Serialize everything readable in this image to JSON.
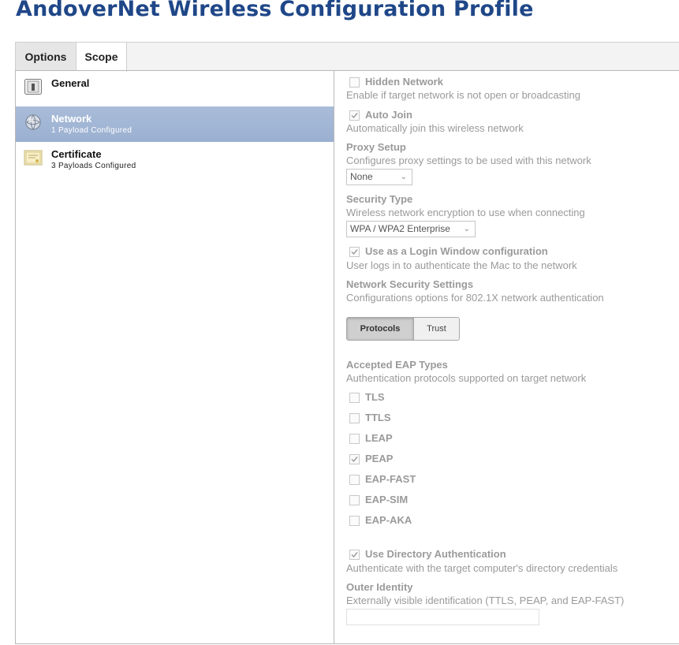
{
  "page_title": "AndoverNet Wireless Configuration Profile",
  "tabs": [
    {
      "label": "Options"
    },
    {
      "label": "Scope"
    }
  ],
  "sidebar": {
    "items": [
      {
        "title": "General",
        "subtitle": ""
      },
      {
        "title": "Network",
        "subtitle": "1 Payload Configured"
      },
      {
        "title": "Certificate",
        "subtitle": "3 Payloads Configured"
      }
    ]
  },
  "network": {
    "hidden_network": {
      "label": "Hidden Network",
      "desc": "Enable if target network is not open or broadcasting",
      "checked": false
    },
    "auto_join": {
      "label": "Auto Join",
      "desc": "Automatically join this wireless network",
      "checked": true
    },
    "proxy_setup": {
      "label": "Proxy Setup",
      "desc": "Configures proxy settings to be used with this network",
      "value": "None"
    },
    "security_type": {
      "label": "Security Type",
      "desc": "Wireless network encryption to use when connecting",
      "value": "WPA / WPA2 Enterprise"
    },
    "login_window": {
      "label": "Use as a Login Window configuration",
      "desc": "User logs in to authenticate the Mac to the network",
      "checked": true
    },
    "network_security": {
      "label": "Network Security Settings",
      "desc": "Configurations options for 802.1X network authentication"
    },
    "segment": {
      "protocols": "Protocols",
      "trust": "Trust"
    },
    "eap": {
      "label": "Accepted EAP Types",
      "desc": "Authentication protocols supported on target network",
      "types": [
        {
          "label": "TLS",
          "checked": false
        },
        {
          "label": "TTLS",
          "checked": false
        },
        {
          "label": "LEAP",
          "checked": false
        },
        {
          "label": "PEAP",
          "checked": true
        },
        {
          "label": "EAP-FAST",
          "checked": false
        },
        {
          "label": "EAP-SIM",
          "checked": false
        },
        {
          "label": "EAP-AKA",
          "checked": false
        }
      ]
    },
    "directory_auth": {
      "label": "Use Directory Authentication",
      "desc": "Authenticate with the target computer's directory credentials",
      "checked": true
    },
    "outer_identity": {
      "label": "Outer Identity",
      "desc": "Externally visible identification (TTLS, PEAP, and EAP-FAST)",
      "value": ""
    }
  }
}
